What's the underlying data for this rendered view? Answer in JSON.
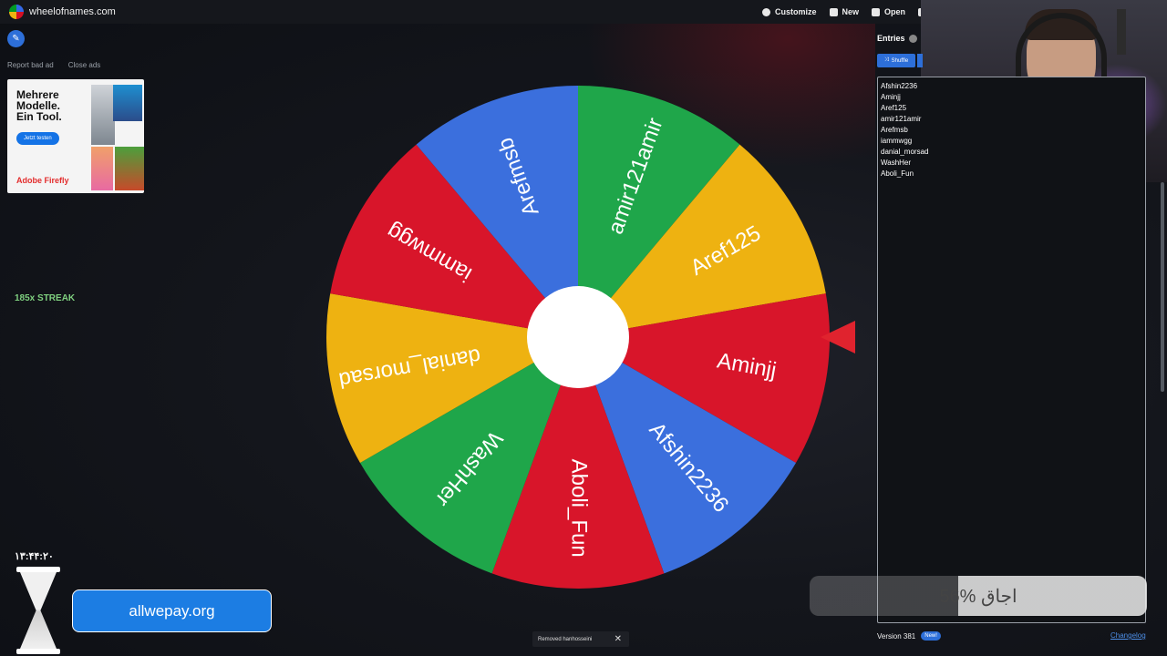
{
  "site": {
    "name": "wheelofnames.com"
  },
  "toolbar": {
    "customize": "Customize",
    "new": "New",
    "open": "Open"
  },
  "ad": {
    "report": "Report bad ad",
    "close": "Close ads",
    "headline_line1": "Mehrere",
    "headline_line2": "Modelle.",
    "headline_line3": "Ein Tool.",
    "cta": "Jetzt testen",
    "brand": "Adobe Firefly"
  },
  "streak": "185x STREAK",
  "wheel": {
    "segments": [
      {
        "label": "amir121amir",
        "color": "#1fa64a"
      },
      {
        "label": "Aref125",
        "color": "#eeb211"
      },
      {
        "label": "Aminjj",
        "color": "#d8152a"
      },
      {
        "label": "Afshin2236",
        "color": "#3b6fdd"
      },
      {
        "label": "Aboli_Fun",
        "color": "#d8152a"
      },
      {
        "label": "WashHer",
        "color": "#1fa64a"
      },
      {
        "label": "danial_morsad",
        "color": "#eeb211"
      },
      {
        "label": "iammwgg",
        "color": "#d8152a"
      },
      {
        "label": "Arefmsb",
        "color": "#3b6fdd"
      }
    ]
  },
  "panel": {
    "tab_label": "Entries",
    "shuffle": "Shuffle",
    "entries": [
      "Afshin2236",
      "Aminjj",
      "Aref125",
      "amir121amir",
      "Arefmsb",
      "iammwgg",
      "danial_morsad",
      "WashHer",
      "Aboli_Fun"
    ],
    "version": "Version 381",
    "new_badge": "New!",
    "changelog": "Changelog"
  },
  "overlay": {
    "percent_text": "56% اجاق",
    "removed_toast": "Removed hanhosseini",
    "timer": "۱۳:۴۴:۲۰",
    "promo": "allwepay.org"
  }
}
